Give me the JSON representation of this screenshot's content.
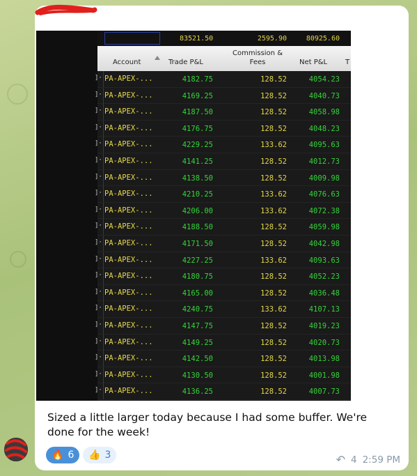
{
  "totals": {
    "trade_pnl": "83521.50",
    "commission": "2595.90",
    "net_pnl": "80925.60"
  },
  "headers": {
    "account": "Account",
    "trade_pnl": "Trade P&L",
    "commission_line1": "Commission &",
    "commission_line2": "Fees",
    "net_pnl": "Net P&L",
    "extra": "T"
  },
  "rows": [
    {
      "account": "PA-APEX-...",
      "trade_pnl": "4182.75",
      "commission": "128.52",
      "net_pnl": "4054.23"
    },
    {
      "account": "PA-APEX-...",
      "trade_pnl": "4169.25",
      "commission": "128.52",
      "net_pnl": "4040.73"
    },
    {
      "account": "PA-APEX-...",
      "trade_pnl": "4187.50",
      "commission": "128.52",
      "net_pnl": "4058.98"
    },
    {
      "account": "PA-APEX-...",
      "trade_pnl": "4176.75",
      "commission": "128.52",
      "net_pnl": "4048.23"
    },
    {
      "account": "PA-APEX-...",
      "trade_pnl": "4229.25",
      "commission": "133.62",
      "net_pnl": "4095.63"
    },
    {
      "account": "PA-APEX-...",
      "trade_pnl": "4141.25",
      "commission": "128.52",
      "net_pnl": "4012.73"
    },
    {
      "account": "PA-APEX-...",
      "trade_pnl": "4138.50",
      "commission": "128.52",
      "net_pnl": "4009.98"
    },
    {
      "account": "PA-APEX-...",
      "trade_pnl": "4210.25",
      "commission": "133.62",
      "net_pnl": "4076.63"
    },
    {
      "account": "PA-APEX-...",
      "trade_pnl": "4206.00",
      "commission": "133.62",
      "net_pnl": "4072.38"
    },
    {
      "account": "PA-APEX-...",
      "trade_pnl": "4188.50",
      "commission": "128.52",
      "net_pnl": "4059.98"
    },
    {
      "account": "PA-APEX-...",
      "trade_pnl": "4171.50",
      "commission": "128.52",
      "net_pnl": "4042.98"
    },
    {
      "account": "PA-APEX-...",
      "trade_pnl": "4227.25",
      "commission": "133.62",
      "net_pnl": "4093.63"
    },
    {
      "account": "PA-APEX-...",
      "trade_pnl": "4180.75",
      "commission": "128.52",
      "net_pnl": "4052.23"
    },
    {
      "account": "PA-APEX-...",
      "trade_pnl": "4165.00",
      "commission": "128.52",
      "net_pnl": "4036.48"
    },
    {
      "account": "PA-APEX-...",
      "trade_pnl": "4240.75",
      "commission": "133.62",
      "net_pnl": "4107.13"
    },
    {
      "account": "PA-APEX-...",
      "trade_pnl": "4147.75",
      "commission": "128.52",
      "net_pnl": "4019.23"
    },
    {
      "account": "PA-APEX-...",
      "trade_pnl": "4149.25",
      "commission": "128.52",
      "net_pnl": "4020.73"
    },
    {
      "account": "PA-APEX-...",
      "trade_pnl": "4142.50",
      "commission": "128.52",
      "net_pnl": "4013.98"
    },
    {
      "account": "PA-APEX-...",
      "trade_pnl": "4130.50",
      "commission": "128.52",
      "net_pnl": "4001.98"
    },
    {
      "account": "PA-APEX-...",
      "trade_pnl": "4136.25",
      "commission": "128.52",
      "net_pnl": "4007.73"
    }
  ],
  "message": {
    "text": "Sized a little larger today because I had some buffer. We're done for the week!"
  },
  "reactions": [
    {
      "emoji": "🔥",
      "emoji_name": "fire-icon",
      "count": "6"
    },
    {
      "emoji": "👍",
      "emoji_name": "thumbs-up-icon",
      "count": "3"
    }
  ],
  "meta": {
    "reply_count": "4",
    "time": "2:59 PM",
    "reply_icon": "reply-arrow-icon"
  },
  "colors": {
    "green_value": "#35d43a",
    "yellow_value": "#e6d84a",
    "reaction_bg": "#4a90d9"
  }
}
